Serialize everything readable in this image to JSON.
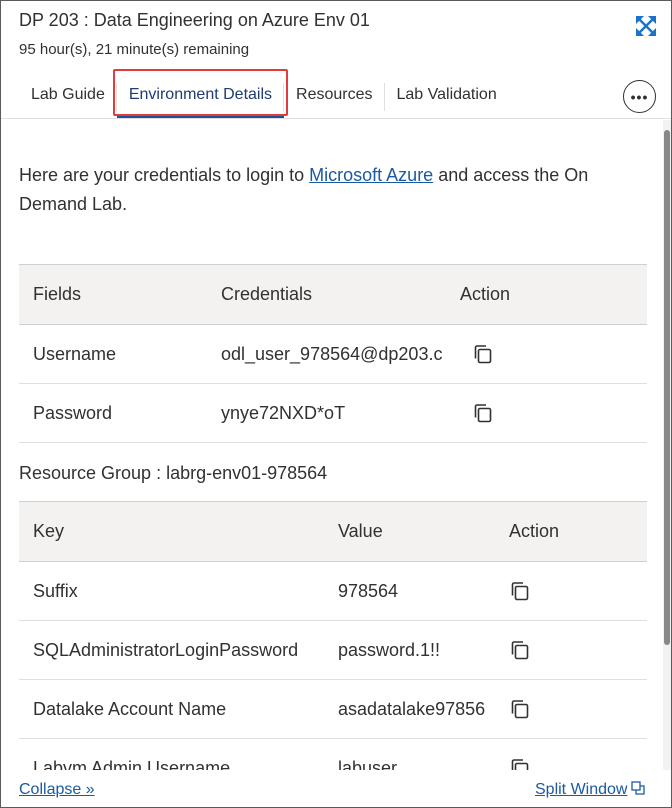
{
  "header": {
    "title": "DP 203 : Data Engineering on Azure Env 01",
    "time_remaining": "95 hour(s), 21 minute(s) remaining",
    "expand_icon": "expand-arrows-icon"
  },
  "tabs": [
    {
      "label": "Lab Guide",
      "active": false
    },
    {
      "label": "Environment Details",
      "active": true
    },
    {
      "label": "Resources",
      "active": false
    },
    {
      "label": "Lab Validation",
      "active": false
    }
  ],
  "more_icon": "more-ellipsis-icon",
  "more_label": "•••",
  "intro": {
    "before": "Here are your credentials to login to ",
    "link": "Microsoft Azure",
    "after": " and access the On Demand Lab."
  },
  "credentials_table": {
    "headers": [
      "Fields",
      "Credentials",
      "Action"
    ],
    "rows": [
      {
        "field": "Username",
        "value": "odl_user_978564@dp203.c"
      },
      {
        "field": "Password",
        "value": "ynye72NXD*oT"
      }
    ]
  },
  "resource_group": {
    "label": "Resource Group : labrg-env01-978564"
  },
  "resource_table": {
    "headers": [
      "Key",
      "Value",
      "Action"
    ],
    "rows": [
      {
        "key": "Suffix",
        "value": "978564"
      },
      {
        "key": "SQLAdministratorLoginPassword",
        "value": "password.1!!"
      },
      {
        "key": "Datalake Account Name",
        "value": "asadatalake97856"
      },
      {
        "key": "Labvm Admin Username",
        "value": "labuser"
      }
    ]
  },
  "footer": {
    "collapse": "Collapse »",
    "split_window": "Split Window"
  },
  "colors": {
    "link": "#1a5aa3",
    "active_tab_underline": "#1f4e9a",
    "highlight_box": "#e03c3c",
    "expand_icon": "#1a73c8"
  }
}
